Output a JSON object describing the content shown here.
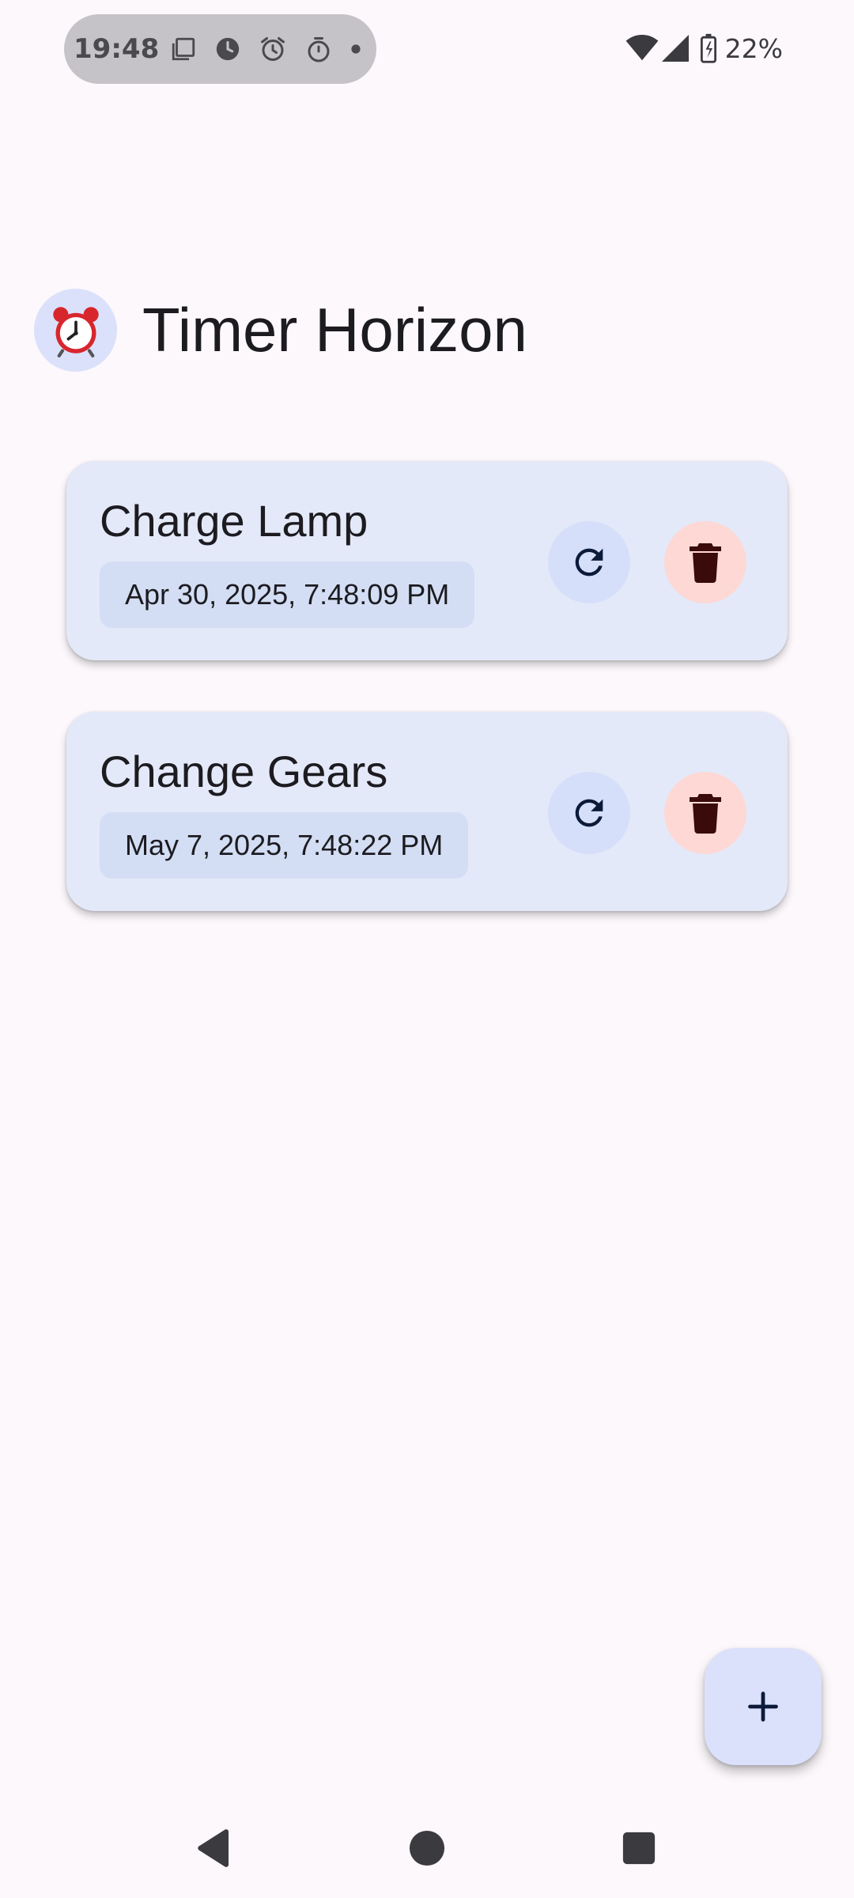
{
  "status_bar": {
    "time": "19:48",
    "battery": "22%",
    "left_icons": [
      "screenshot-icon",
      "clock-icon",
      "alarm-icon",
      "timer-icon",
      "dot-icon"
    ],
    "right_icons": [
      "wifi-icon",
      "cell-signal-icon",
      "battery-charging-icon"
    ]
  },
  "header": {
    "icon": "alarm-clock-icon",
    "title": "Timer Horizon"
  },
  "timers": [
    {
      "name": "Charge Lamp",
      "date": "Apr 30, 2025, 7:48:09 PM",
      "reset_icon": "refresh-icon",
      "delete_icon": "trash-icon"
    },
    {
      "name": "Change Gears",
      "date": "May 7, 2025, 7:48:22 PM",
      "reset_icon": "refresh-icon",
      "delete_icon": "trash-icon"
    }
  ],
  "fab": {
    "icon": "plus-icon"
  },
  "nav": {
    "back_icon": "back-triangle-icon",
    "home_icon": "home-circle-icon",
    "recents_icon": "recents-square-icon"
  },
  "colors": {
    "background": "#fcf8fc",
    "card": "#e4e9f9",
    "date_chip": "#d3def4",
    "reset_button": "#d6dffa",
    "delete_button": "#fdd8d5",
    "delete_icon": "#3b0a0a",
    "fab": "#dbe1fb",
    "status_pill": "#c5c3c7"
  }
}
